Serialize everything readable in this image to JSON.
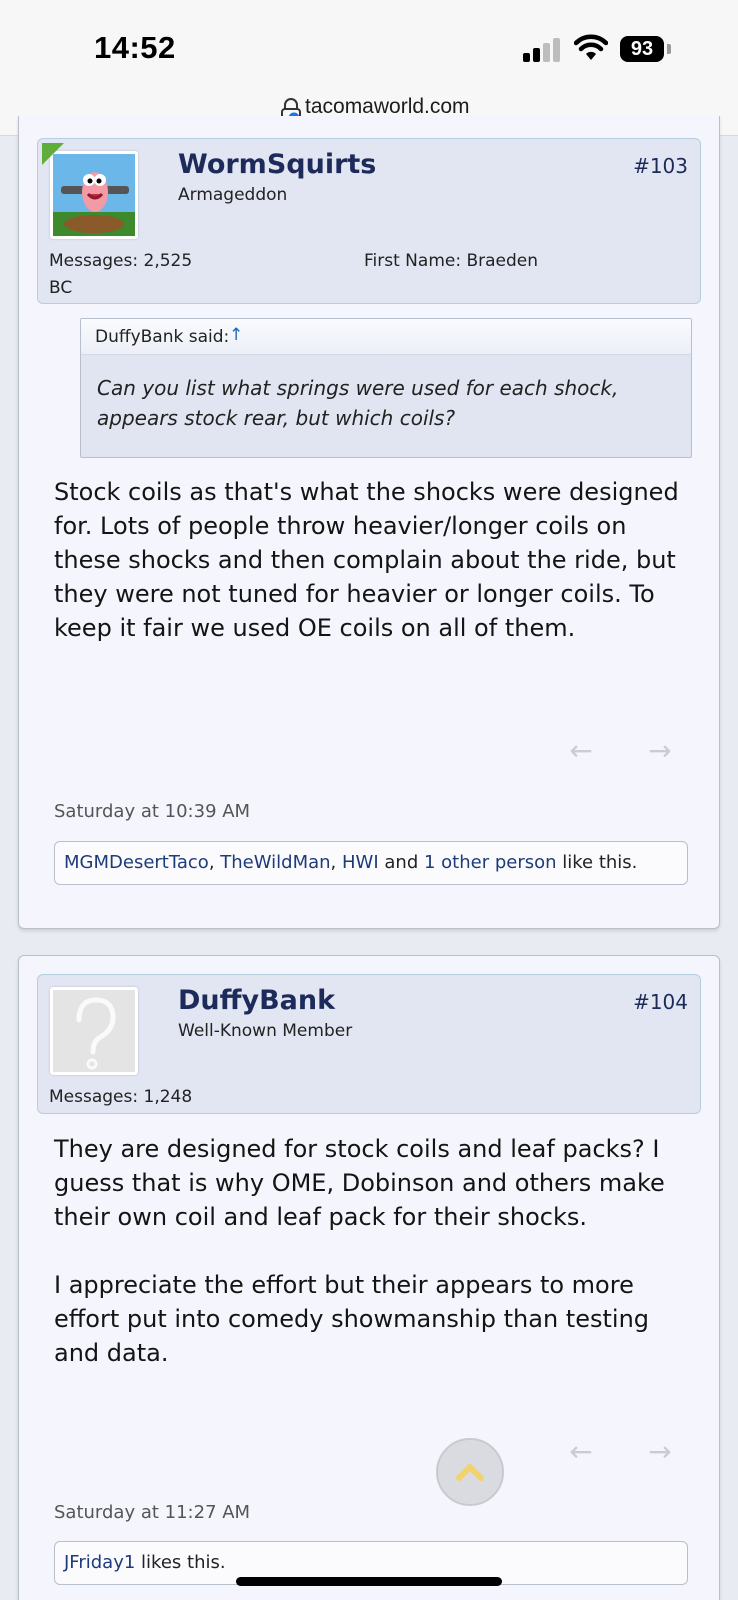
{
  "status_bar": {
    "time": "14:52",
    "battery": "93"
  },
  "browser": {
    "url": "tacomaworld.com"
  },
  "colors": {
    "username": "#1d2b5a",
    "link": "#1d3a7a",
    "user_box_bg": "#e2e6f3",
    "post_bg": "#f5f6fd"
  },
  "posts": [
    {
      "username": "WormSquirts",
      "user_title": "Armageddon",
      "post_number": "#103",
      "messages_label": "Messages:",
      "messages_count": "2,525",
      "first_name_label": "First Name:",
      "first_name": "Braeden",
      "location": "BC",
      "quote": {
        "author": "DuffyBank said:",
        "arrow": "↑",
        "text": "Can you list what springs were used for each shock, appears stock rear, but which coils?"
      },
      "message": "Stock coils as that's what the shocks were designed for. Lots of people throw heavier/longer coils on these shocks and then complain about the ride, but they were not tuned for heavier or longer coils. To keep it fair we used OE coils on all of them.",
      "timestamp": "Saturday at 10:39 AM",
      "likes": {
        "user1": "MGMDesertTaco",
        "sep1": ", ",
        "user2": "TheWildMan",
        "sep2": ", ",
        "user3": "HWI",
        "and": " and ",
        "others": "1 other person",
        "suffix": " like this."
      }
    },
    {
      "username": "DuffyBank",
      "user_title": "Well-Known Member",
      "post_number": "#104",
      "messages_label": "Messages:",
      "messages_count": "1,248",
      "message": "They are designed for stock coils and leaf packs? I guess that is why OME, Dobinson and others make their own coil and leaf pack for their shocks.\n\nI appreciate the effort but their appears to more effort put into comedy showmanship than testing and data.",
      "timestamp": "Saturday at 11:27 AM",
      "likes": {
        "user1": "JFriday1",
        "suffix": " likes this."
      }
    }
  ]
}
